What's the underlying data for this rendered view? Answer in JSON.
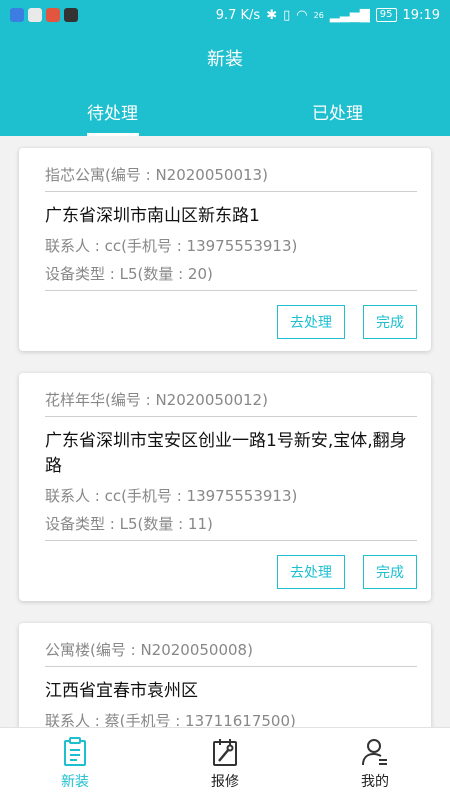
{
  "status_bar": {
    "speed": "9.7 K/s",
    "battery": "95",
    "time": "19:19",
    "signal_text": "26"
  },
  "header": {
    "title": "新装",
    "tabs": [
      {
        "label": "待处理",
        "active": true
      },
      {
        "label": "已处理",
        "active": false
      }
    ]
  },
  "cards": [
    {
      "name": "指芯公寓(编号 : N2020050013)",
      "address": "广东省深圳市南山区新东路1",
      "contact": "联系人 : cc(手机号 : 13975553913)",
      "device": "设备类型 : L5(数量 : 20)",
      "process_label": "去处理",
      "done_label": "完成"
    },
    {
      "name": "花样年华(编号 : N2020050012)",
      "address": "广东省深圳市宝安区创业一路1号新安,宝体,翻身路",
      "contact": "联系人 : cc(手机号 : 13975553913)",
      "device": "设备类型 : L5(数量 : 11)",
      "process_label": "去处理",
      "done_label": "完成"
    },
    {
      "name": "公寓楼(编号 : N2020050008)",
      "address": "江西省宜春市袁州区",
      "contact": "联系人 : 蔡(手机号 : 13711617500)"
    }
  ],
  "bottom_nav": [
    {
      "label": "新装",
      "icon": "clipboard-icon",
      "active": true
    },
    {
      "label": "报修",
      "icon": "repair-icon",
      "active": false
    },
    {
      "label": "我的",
      "icon": "user-icon",
      "active": false
    }
  ],
  "colors": {
    "accent": "#1ebfcf",
    "background": "#f2f2f2"
  }
}
